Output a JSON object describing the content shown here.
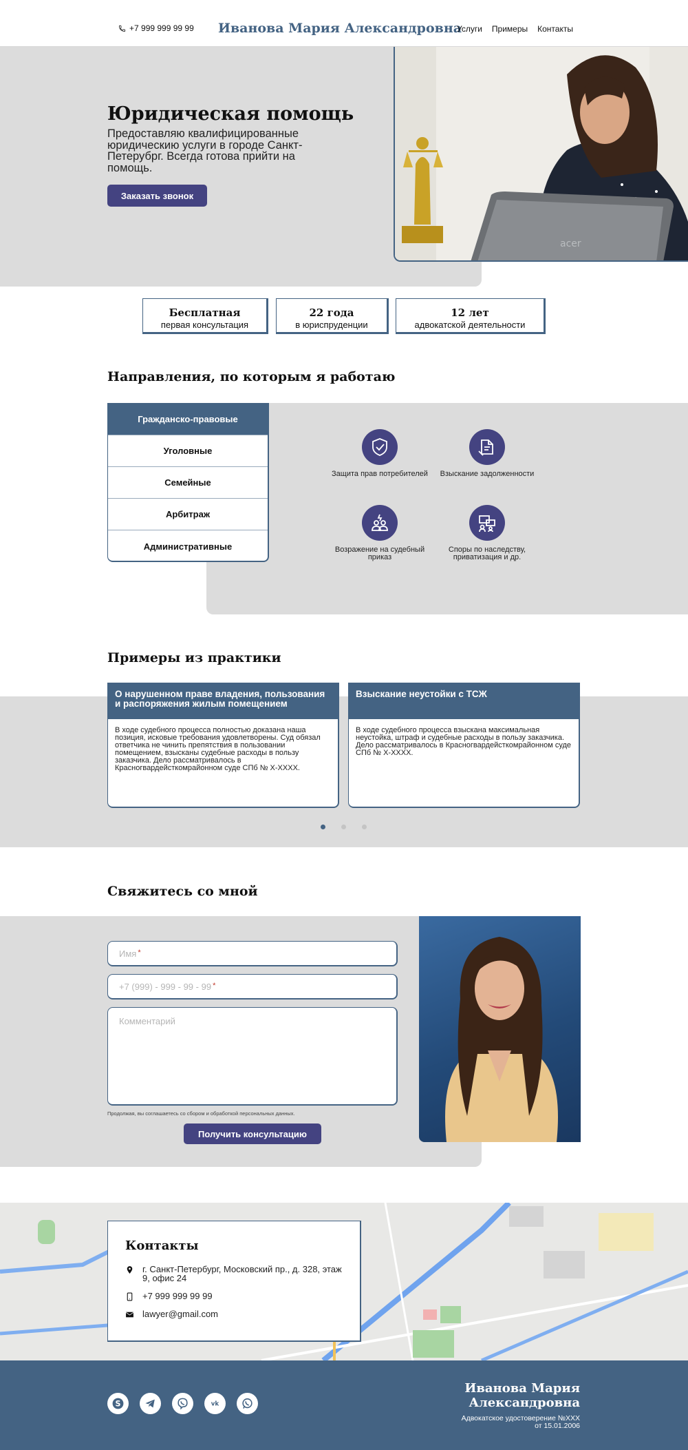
{
  "header": {
    "phone": "+7 999 999 99 99",
    "name": "Иванова Мария Александровна",
    "nav": [
      "Услуги",
      "Примеры",
      "Контакты"
    ]
  },
  "hero": {
    "title": "Юридическая помощь",
    "subtitle": "Предоставляю квалифицированные юридическию услуги в городе Санкт-Петерубрг. Всегда готова прийти на помощь.",
    "button": "Заказать звонок"
  },
  "stats": [
    {
      "big": "Бесплатная",
      "small": "первая консультация"
    },
    {
      "big": "22 года",
      "small": "в юриспруденции"
    },
    {
      "big": "12 лет",
      "small": "адвокатской деятельности"
    }
  ],
  "directions": {
    "title": "Направления, по которым я работаю",
    "tabs": [
      "Гражданско-правовые",
      "Уголовные",
      "Семейные",
      "Арбитраж",
      "Административные"
    ],
    "active_tab": 0,
    "services": [
      {
        "label": "Защита прав потребителей",
        "icon": "shield-check-icon"
      },
      {
        "label": "Взыскание задолженности",
        "icon": "debt-document-icon"
      },
      {
        "label": "Возражение на судебный приказ",
        "icon": "people-objection-icon"
      },
      {
        "label": "Споры по наследству, приватизация и др.",
        "icon": "inheritance-dispute-icon"
      }
    ]
  },
  "cases": {
    "title": "Примеры из практики",
    "items": [
      {
        "title": "О нарушенном праве владения, пользования и распоряжения жилым помещением",
        "text": "В ходе судебного процесса полностью доказана наша позиция, исковые требования удовлетворены. Суд обязал ответчика не чинить препятствия в пользовании помещением, взысканы судебные расходы в пользу заказчика. Дело рассматривалось в Красногвардейсткомрайонном суде СПб № Х-ХХХХ."
      },
      {
        "title": "Взыскание неустойки с ТСЖ",
        "text": "В ходе судебного процесса взыскана максимальная неустойка, штраф и судебные расходы в пользу заказчика. Дело рассматривалось в Красногвардейсткомрайонном суде СПб № Х-ХХХХ."
      }
    ]
  },
  "contact_form": {
    "title": "Свяжитесь со мной",
    "name_placeholder": "Имя",
    "phone_placeholder": "+7 (999) - 999 - 99 - 99",
    "comment_placeholder": "Комментарий",
    "required_mark": "*",
    "consent": "Продолжая, вы соглашаетесь со сбором и обработкой персональных данных.",
    "button": "Получить консультацию"
  },
  "contacts": {
    "title": "Контакты",
    "address": "г. Санкт-Петербург, Московский пр., д. 328, этаж 9, офис 24",
    "phone": "+7 999 999 99 99",
    "email": "lawyer@gmail.com"
  },
  "footer": {
    "name": "Иванова Мария Александровна",
    "cert": "Адвокатское удостоверение №ХХХ от 15.01.2006",
    "socials": [
      "skype-icon",
      "telegram-icon",
      "viber-icon",
      "vk-icon",
      "whatsapp-icon"
    ]
  },
  "colors": {
    "primary": "#446383",
    "button": "#444381",
    "panel": "#dcdcdc"
  }
}
